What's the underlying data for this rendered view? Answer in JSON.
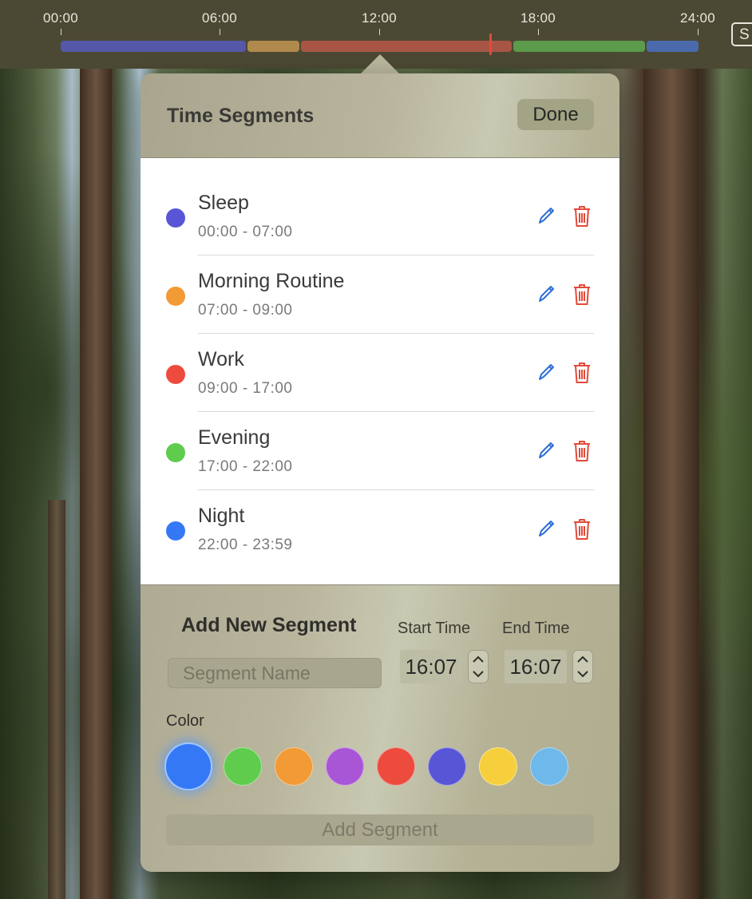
{
  "timeline": {
    "ticks": [
      "00:00",
      "06:00",
      "12:00",
      "18:00",
      "24:00"
    ],
    "now_marker_time": "16:07",
    "segments": [
      {
        "name": "Sleep",
        "color": "#5557a8"
      },
      {
        "name": "Morning Routine",
        "color": "#b08a4c"
      },
      {
        "name": "Work",
        "color": "#a85546"
      },
      {
        "name": "Evening",
        "color": "#5c9a4c"
      },
      {
        "name": "Night",
        "color": "#4a6aac"
      }
    ],
    "side_button_label": "S"
  },
  "popover": {
    "title": "Time Segments",
    "done_label": "Done"
  },
  "segments": [
    {
      "name": "Sleep",
      "time": "00:00 - 07:00",
      "color": "#5856d6",
      "edit_icon": "pencil-icon",
      "delete_icon": "trash-icon"
    },
    {
      "name": "Morning Routine",
      "time": "07:00 - 09:00",
      "color": "#f29a35",
      "edit_icon": "pencil-icon",
      "delete_icon": "trash-icon"
    },
    {
      "name": "Work",
      "time": "09:00 - 17:00",
      "color": "#ec4b3d",
      "edit_icon": "pencil-icon",
      "delete_icon": "trash-icon"
    },
    {
      "name": "Evening",
      "time": "17:00 - 22:00",
      "color": "#5fcc4e",
      "edit_icon": "pencil-icon",
      "delete_icon": "trash-icon"
    },
    {
      "name": "Night",
      "time": "22:00 - 23:59",
      "color": "#3478f6",
      "edit_icon": "pencil-icon",
      "delete_icon": "trash-icon"
    }
  ],
  "add_form": {
    "title": "Add New Segment",
    "name_placeholder": "Segment Name",
    "name_value": "",
    "start_label": "Start Time",
    "end_label": "End Time",
    "start_value": "16:07",
    "end_value": "16:07",
    "color_label": "Color",
    "colors": [
      "#3478f6",
      "#5fcc4e",
      "#f29a35",
      "#a855d6",
      "#ec4b3d",
      "#5856d6",
      "#f7cf3c",
      "#6fb8ea"
    ],
    "selected_color": "#3478f6",
    "add_label": "Add Segment"
  },
  "accent_colors": {
    "edit": "#2f6fd6",
    "delete": "#e24a3a"
  }
}
